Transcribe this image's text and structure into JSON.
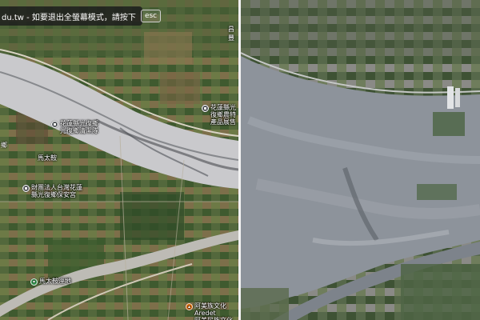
{
  "fullscreen_notice": {
    "text": "du.tw - 如要退出全螢幕模式，請按下",
    "key_label": "esc"
  },
  "map_labels": {
    "road_mark": "昌豐",
    "left_edge_mark": "鄉"
  },
  "pois": [
    {
      "label": "花蓮縣光復鄉\n光復鄉清潔隊",
      "pin": "gray",
      "icon": "building-icon"
    },
    {
      "label": "花蓮縣光\n復鄉農特\n產品展售",
      "pin": "gray",
      "icon": "building-icon"
    },
    {
      "label": "財團法人台灣花蓮\n縣光復鄉保安宮",
      "pin": "gray",
      "icon": "building-icon"
    },
    {
      "label": "馬太鞍",
      "pin": "gray",
      "icon": "building-icon"
    },
    {
      "label": "馬太鞍溼地",
      "pin": "green",
      "icon": "park-icon"
    },
    {
      "label": "阿美族文化Aredet\n阿美民族文化藝術館",
      "pin": "orange",
      "icon": "museum-icon"
    }
  ],
  "colors": {
    "river_silt_left": "#c9c9cc",
    "flood_silt_right": "#8d939b",
    "vegetation": "#3f5a32",
    "farmland": "#5f6e45",
    "pin_gray": "#8a8f96",
    "pin_green": "#3aa757",
    "pin_orange": "#e8710a"
  }
}
